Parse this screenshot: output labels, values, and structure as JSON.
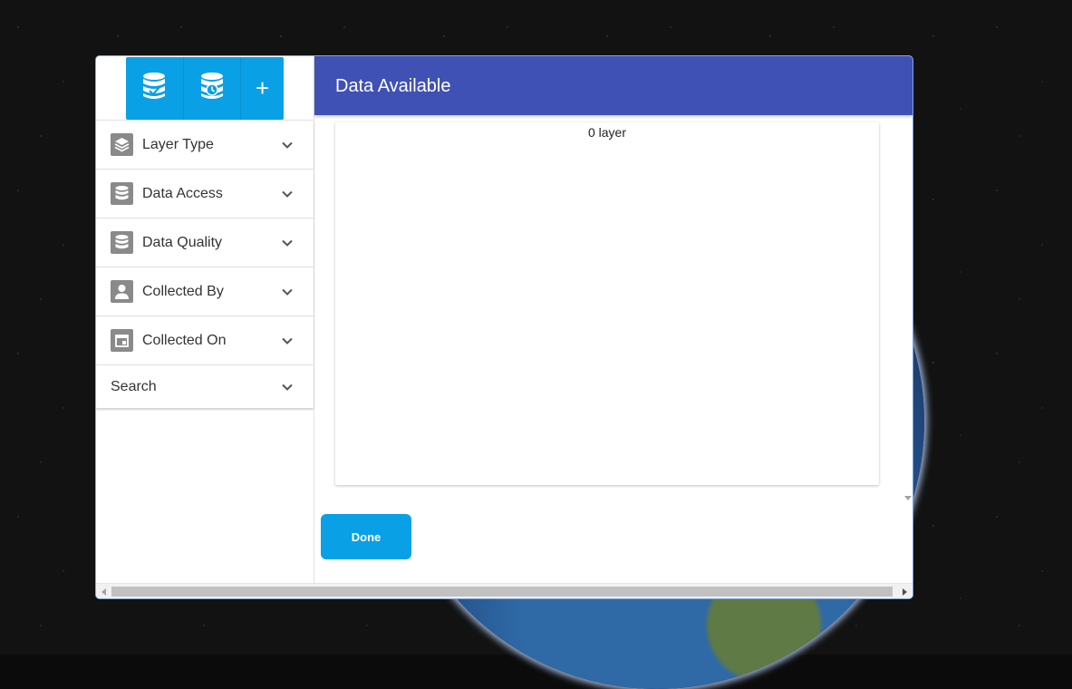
{
  "header": {
    "title": "Data Available"
  },
  "toolbar": {
    "buttons": [
      {
        "icon": "database-check-icon"
      },
      {
        "icon": "database-clock-icon"
      },
      {
        "icon": "plus-icon",
        "label": "+"
      }
    ]
  },
  "filters": {
    "items": [
      {
        "label": "Layer Type",
        "icon": "layers-icon"
      },
      {
        "label": "Data Access",
        "icon": "database-icon"
      },
      {
        "label": "Data Quality",
        "icon": "database-icon"
      },
      {
        "label": "Collected By",
        "icon": "person-icon"
      },
      {
        "label": "Collected On",
        "icon": "calendar-icon"
      }
    ],
    "search_label": "Search"
  },
  "content": {
    "layer_count": "0 layer"
  },
  "actions": {
    "done_label": "Done"
  },
  "colors": {
    "header": "#3f51b5",
    "accent": "#0aa0e6",
    "icon_gray": "#8a8a8a"
  }
}
